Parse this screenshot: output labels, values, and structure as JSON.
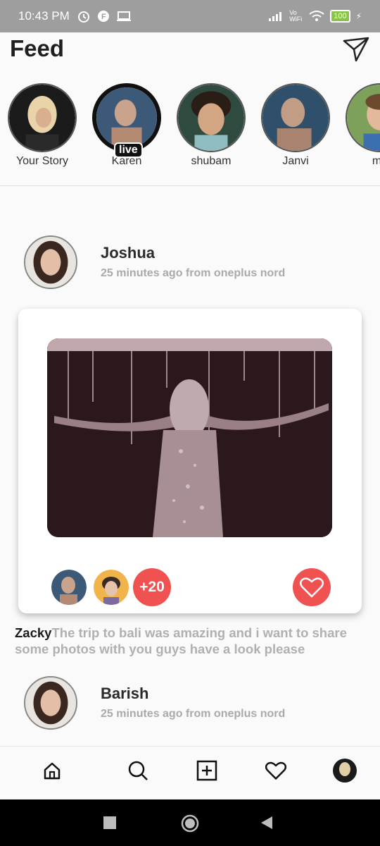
{
  "status_bar": {
    "time": "10:43 PM",
    "battery": "100",
    "network": "Vo WiFi"
  },
  "header": {
    "title": "Feed"
  },
  "stories": [
    {
      "name": "Your Story",
      "live": false
    },
    {
      "name": "Karen",
      "live": true
    },
    {
      "name": "shubam",
      "live": false
    },
    {
      "name": "Janvi",
      "live": false
    },
    {
      "name": "me",
      "live": false
    }
  ],
  "live_label": "live",
  "posts": [
    {
      "user": "Joshua",
      "meta": "25 minutes ago from oneplus nord"
    },
    {
      "user": "Barish",
      "meta": "25 minutes ago from oneplus nord"
    }
  ],
  "card": {
    "more_likes": "+20"
  },
  "caption": {
    "author": "Zacky",
    "text": "The trip to bali was amazing and i want to share some photos with you guys have a look please"
  },
  "nav": [
    "home-icon",
    "search-icon",
    "add-post-icon",
    "heart-icon",
    "profile-avatar"
  ],
  "colors": {
    "accent": "#f05151",
    "status_bar": "#9e9e9e"
  }
}
